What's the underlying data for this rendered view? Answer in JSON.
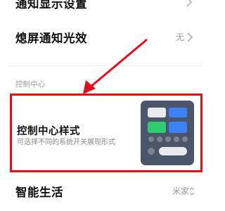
{
  "settings": {
    "notification_display": {
      "label": "通知显示设置"
    },
    "screen_off_light": {
      "label": "熄屏通知光效",
      "value": "无"
    },
    "section_header": "控制中心",
    "control_center_style": {
      "title": "控制中心样式",
      "description": "可选择不同的系统开关展现形式"
    },
    "smart_life": {
      "label": "智能生活",
      "value": "米家"
    }
  },
  "icons": {
    "chevron": "chevron-right-icon",
    "updown": "chevron-updown-icon",
    "preview": "control-center-preview-icon"
  },
  "colors": {
    "highlight": "#e0101a",
    "preview_bg": "#4c566a",
    "tile_green": "#2ecc71",
    "tile_blue": "#3b82f6"
  }
}
